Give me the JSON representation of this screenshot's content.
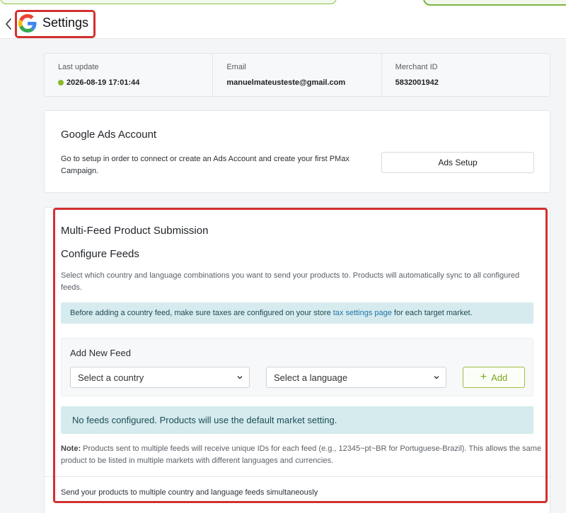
{
  "header": {
    "title": "Settings",
    "back_icon": "chevron-left-icon",
    "logo_icon": "google-g-logo"
  },
  "info": {
    "last_update_label": "Last update",
    "last_update_value": "2026-08-19 17:01:44",
    "status_color": "#8ab72b",
    "email_label": "Email",
    "email_value": "manuelmateusteste@gmail.com",
    "merchant_label": "Merchant ID",
    "merchant_value": "5832001942"
  },
  "ads": {
    "title": "Google Ads Account",
    "description": "Go to setup in order to connect or create an Ads Account and create your first PMax Campaign.",
    "button_label": "Ads Setup"
  },
  "feeds": {
    "section_title": "Multi-Feed Product Submission",
    "configure_title": "Configure Feeds",
    "configure_desc": "Select which country and language combinations you want to send your products to. Products will automatically sync to all configured feeds.",
    "alert_before": "Before adding a country feed, make sure taxes are configured on your store",
    "alert_link": "tax settings page",
    "alert_after": "for each target market.",
    "add_title": "Add New Feed",
    "country_placeholder": "Select a country",
    "language_placeholder": "Select a language",
    "add_label": "Add",
    "no_feeds": "No feeds configured. Products will use the default market setting.",
    "note_label": "Note:",
    "note_text": "Products sent to multiple feeds will receive unique IDs for each feed (e.g., 12345~pt~BR for Portuguese-Brazil). This allows the same product to be listed in multiple markets with different languages and currencies.",
    "footer_text": "Send your products to multiple country and language feeds simultaneously"
  },
  "colors": {
    "accent_green": "#8ab72b",
    "highlight_red": "#d32f2f",
    "alert_bg": "#d5ebee",
    "link": "#1f76a8"
  }
}
